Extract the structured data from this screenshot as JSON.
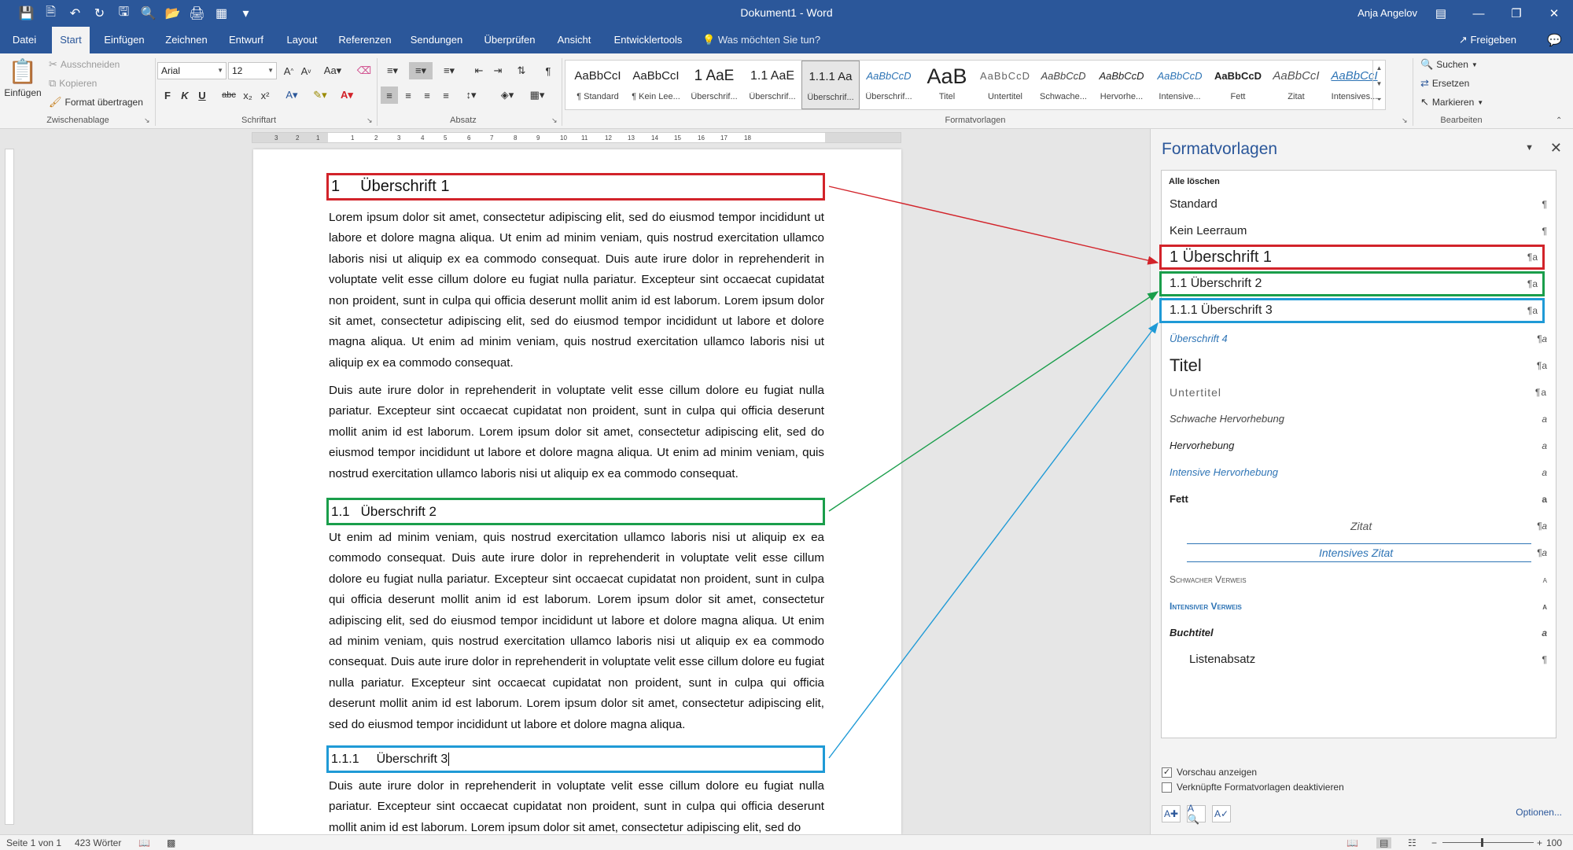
{
  "window": {
    "title": "Dokument1 - Word",
    "user": "Anja Angelov",
    "quick_access_icons": [
      "save-icon",
      "new-document-icon",
      "undo-icon",
      "redo-icon",
      "save-as-icon",
      "print-preview-icon",
      "open-icon",
      "quick-print-icon",
      "table-icon",
      "customize-icon"
    ]
  },
  "tabs": [
    {
      "label": "Datei",
      "active": false
    },
    {
      "label": "Start",
      "active": true
    },
    {
      "label": "Einfügen",
      "active": false
    },
    {
      "label": "Zeichnen",
      "active": false
    },
    {
      "label": "Entwurf",
      "active": false
    },
    {
      "label": "Layout",
      "active": false
    },
    {
      "label": "Referenzen",
      "active": false
    },
    {
      "label": "Sendungen",
      "active": false
    },
    {
      "label": "Überprüfen",
      "active": false
    },
    {
      "label": "Ansicht",
      "active": false
    },
    {
      "label": "Entwicklertools",
      "active": false
    }
  ],
  "tell_me": "Was möchten Sie tun?",
  "share_label": "Freigeben",
  "ribbon": {
    "clipboard": {
      "paste": "Einfügen",
      "cut": "Ausschneiden",
      "copy": "Kopieren",
      "format_painter": "Format übertragen",
      "group_label": "Zwischenablage"
    },
    "font": {
      "family": "Arial",
      "size": "12",
      "group_label": "Schriftart",
      "buttons": [
        "F",
        "K",
        "U",
        "abc",
        "x₂",
        "x²"
      ]
    },
    "paragraph": {
      "group_label": "Absatz"
    },
    "styles": {
      "group_label": "Formatvorlagen",
      "gallery": [
        {
          "preview": "AaBbCcI",
          "name": "¶ Standard",
          "selected": false
        },
        {
          "preview": "AaBbCcI",
          "name": "¶ Kein Lee...",
          "selected": false
        },
        {
          "preview": "1 AaE",
          "name": "Überschrif...",
          "selected": false
        },
        {
          "preview": "1.1 AaE",
          "name": "Überschrif...",
          "selected": false
        },
        {
          "preview": "1.1.1 Aa",
          "name": "Überschrif...",
          "selected": true
        },
        {
          "preview": "AaBbCcD",
          "name": "Überschrif...",
          "selected": false
        },
        {
          "preview": "AaB",
          "name": "Titel",
          "selected": false
        },
        {
          "preview": "AaBbCcD",
          "name": "Untertitel",
          "selected": false
        },
        {
          "preview": "AaBbCcD",
          "name": "Schwache...",
          "selected": false
        },
        {
          "preview": "AaBbCcD",
          "name": "Hervorhe...",
          "selected": false
        },
        {
          "preview": "AaBbCcD",
          "name": "Intensive...",
          "selected": false
        },
        {
          "preview": "AaBbCcD",
          "name": "Fett",
          "selected": false
        },
        {
          "preview": "AaBbCcI",
          "name": "Zitat",
          "selected": false
        },
        {
          "preview": "AaBbCcI",
          "name": "Intensives...",
          "selected": false
        }
      ]
    },
    "editing": {
      "find": "Suchen",
      "replace": "Ersetzen",
      "select": "Markieren",
      "group_label": "Bearbeiten"
    }
  },
  "ruler_ticks": [
    "3",
    "2",
    "1",
    "1",
    "2",
    "3",
    "4",
    "5",
    "6",
    "7",
    "8",
    "9",
    "10",
    "11",
    "12",
    "13",
    "14",
    "15",
    "16",
    "17",
    "18"
  ],
  "document": {
    "heading1": {
      "number": "1",
      "text": "Überschrift 1"
    },
    "para1": "Lorem ipsum dolor sit amet, consectetur adipiscing elit, sed do eiusmod tempor incididunt ut labore et dolore magna aliqua. Ut enim ad minim veniam, quis nostrud exercitation ullamco laboris nisi ut aliquip ex ea commodo consequat. Duis aute irure dolor in reprehenderit in voluptate velit esse cillum dolore eu fugiat nulla pariatur. Excepteur sint occaecat cupidatat non proident, sunt in culpa qui officia deserunt mollit anim id est laborum. Lorem ipsum dolor sit amet, consectetur adipiscing elit, sed do eiusmod tempor incididunt ut labore et dolore magna aliqua. Ut enim ad minim veniam, quis nostrud exercitation ullamco laboris nisi ut aliquip ex ea commodo consequat.",
    "para2": "Duis aute irure dolor in reprehenderit in voluptate velit esse cillum dolore eu fugiat nulla pariatur. Excepteur sint occaecat cupidatat non proident, sunt in culpa qui officia deserunt mollit anim id est laborum. Lorem ipsum dolor sit amet, consectetur adipiscing elit, sed do eiusmod tempor incididunt ut labore et dolore magna aliqua. Ut enim ad minim veniam, quis nostrud exercitation ullamco laboris nisi ut aliquip ex ea commodo consequat.",
    "heading2": {
      "number": "1.1",
      "text": "Überschrift 2"
    },
    "para3": "Ut enim ad minim veniam, quis nostrud exercitation ullamco laboris nisi ut aliquip ex ea commodo consequat. Duis aute irure dolor in reprehenderit in voluptate velit esse cillum dolore eu fugiat nulla pariatur. Excepteur sint occaecat cupidatat non proident, sunt in culpa qui officia deserunt mollit anim id est laborum. Lorem ipsum dolor sit amet, consectetur adipiscing elit, sed do eiusmod tempor incididunt ut labore et dolore magna aliqua. Ut enim ad minim veniam, quis nostrud exercitation ullamco laboris nisi ut aliquip ex ea commodo consequat. Duis aute irure dolor in reprehenderit in voluptate velit esse cillum dolore eu fugiat nulla pariatur. Excepteur sint occaecat cupidatat non proident, sunt in culpa qui officia deserunt mollit anim id est laborum. Lorem ipsum dolor sit amet, consectetur adipiscing elit, sed do eiusmod tempor incididunt ut labore et dolore magna aliqua.",
    "heading3": {
      "number": "1.1.1",
      "text": "Überschrift 3"
    },
    "para4": "Duis aute irure dolor in reprehenderit in voluptate velit esse cillum dolore eu fugiat nulla pariatur. Excepteur sint occaecat cupidatat non proident, sunt in culpa qui officia deserunt mollit anim id est laborum. Lorem ipsum dolor sit amet, consectetur adipiscing elit, sed do"
  },
  "styles_pane": {
    "title": "Formatvorlagen",
    "clear_all": "Alle löschen",
    "items": [
      {
        "name": "Standard",
        "mark": "¶"
      },
      {
        "name": "Kein Leerraum",
        "mark": "¶"
      },
      {
        "name": "1  Überschrift 1",
        "mark": "¶a"
      },
      {
        "name": "1.1  Überschrift 2",
        "mark": "¶a"
      },
      {
        "name": "1.1.1  Überschrift 3",
        "mark": "¶a"
      },
      {
        "name": "Überschrift 4",
        "mark": "¶a"
      },
      {
        "name": "Titel",
        "mark": "¶a"
      },
      {
        "name": "Untertitel",
        "mark": "¶a"
      },
      {
        "name": "Schwache Hervorhebung",
        "mark": "a"
      },
      {
        "name": "Hervorhebung",
        "mark": "a"
      },
      {
        "name": "Intensive Hervorhebung",
        "mark": "a"
      },
      {
        "name": "Fett",
        "mark": "a"
      },
      {
        "name": "Zitat",
        "mark": "¶a"
      },
      {
        "name": "Intensives Zitat",
        "mark": "¶a"
      },
      {
        "name": "Schwacher Verweis",
        "mark": "a"
      },
      {
        "name": "Intensiver Verweis",
        "mark": "a"
      },
      {
        "name": "Buchtitel",
        "mark": "a"
      },
      {
        "name": "Listenabsatz",
        "mark": "¶"
      }
    ],
    "show_preview": {
      "label": "Vorschau anzeigen",
      "checked": true
    },
    "disable_linked": {
      "label": "Verknüpfte Formatvorlagen deaktivieren",
      "checked": false
    },
    "options": "Optionen..."
  },
  "status_bar": {
    "page": "Seite 1 von 1",
    "words": "423 Wörter",
    "zoom": "100 %"
  },
  "colors": {
    "word_blue": "#2b579a",
    "heading1_box": "#d2232a",
    "heading2_box": "#1a9e4b",
    "heading3_box": "#1f9ad6",
    "accent_text": "#2e74b5"
  }
}
